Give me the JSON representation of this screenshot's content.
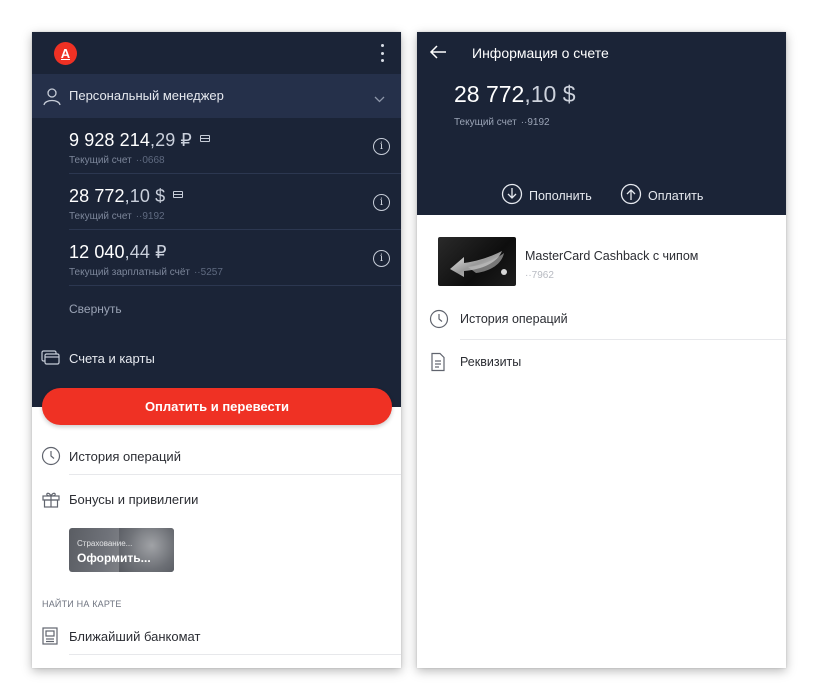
{
  "left_screen": {
    "menu": {
      "personal_manager": "Персональный менеджер"
    },
    "accounts": [
      {
        "amount_int": "9 928 214",
        "amount_frac": ",29 ₽",
        "type": "Текущий счет",
        "number": "··0668",
        "has_card": true
      },
      {
        "amount_int": "28 772",
        "amount_frac": ",10 $",
        "type": "Текущий счет",
        "number": "··9192",
        "has_card": true
      },
      {
        "amount_int": "12 040",
        "amount_frac": ",44 ₽",
        "type": "Текущий зарплатный счёт",
        "number": "··5257",
        "has_card": false
      }
    ],
    "collapse_label": "Свернуть",
    "accounts_and_cards_label": "Счета и карты",
    "pay_button_label": "Оплатить и перевести",
    "list": {
      "history": "История операций",
      "bonuses": "Бонусы и привилегии"
    },
    "promo": {
      "small_text": "Страхование...",
      "big_text": "Оформить..."
    },
    "map_section_header": "НАЙТИ НА КАРТЕ",
    "nearest_atm": "Ближайший банкомат",
    "colors": {
      "dark_bg": "#1b2437",
      "accent_red": "#ef3124"
    }
  },
  "right_screen": {
    "title": "Информация о счете",
    "amount_int": "28 772",
    "amount_frac": ",10 $",
    "account_type": "Текущий счет",
    "account_number": "··9192",
    "actions": {
      "top_up": "Пополнить",
      "pay": "Оплатить"
    },
    "card": {
      "name": "MasterCard Cashback с чипом",
      "number": "··7962"
    },
    "list": {
      "history": "История операций",
      "requisites": "Реквизиты"
    }
  }
}
